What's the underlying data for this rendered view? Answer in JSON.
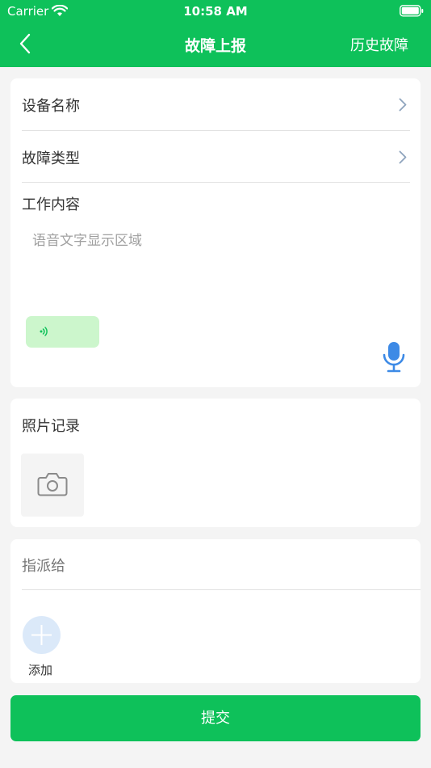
{
  "status_bar": {
    "carrier": "Carrier",
    "time": "10:58 AM"
  },
  "nav": {
    "title": "故障上报",
    "history_label": "历史故障"
  },
  "form": {
    "device_name_label": "设备名称",
    "fault_type_label": "故障类型",
    "work_content_label": "工作内容",
    "voice_text_placeholder": "语音文字显示区域"
  },
  "photos": {
    "label": "照片记录"
  },
  "assign": {
    "placeholder": "指派给",
    "add_label": "添加"
  },
  "submit_label": "提交",
  "colors": {
    "brand_green": "#0ec15a",
    "voice_bubble": "#ccf6cc",
    "mic_blue": "#3d8ae6",
    "add_circle": "#dbe9f9"
  }
}
